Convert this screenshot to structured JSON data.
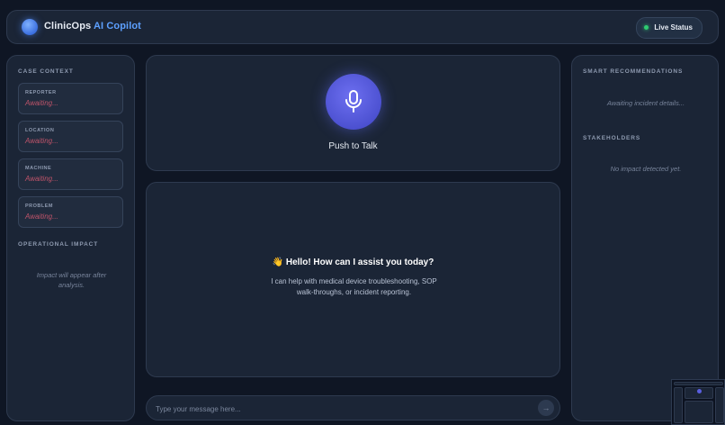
{
  "header": {
    "brand_name": "ClinicOps",
    "brand_accent": "AI Copilot",
    "status_label": "Live Status"
  },
  "case_context": {
    "title": "CASE CONTEXT",
    "fields": [
      {
        "label": "REPORTER",
        "value": "Awaiting..."
      },
      {
        "label": "LOCATION",
        "value": "Awaiting..."
      },
      {
        "label": "MACHINE",
        "value": "Awaiting..."
      },
      {
        "label": "PROBLEM",
        "value": "Awaiting..."
      }
    ]
  },
  "operational_impact": {
    "title": "OPERATIONAL IMPACT",
    "placeholder_line1": "Impact will appear after",
    "placeholder_line2": "analysis."
  },
  "talk": {
    "label": "Push to Talk",
    "icon": "microphone-icon"
  },
  "chat": {
    "greeting_title": "👋 Hello! How can I assist you today?",
    "greeting_line1": "I can help with medical device troubleshooting, SOP",
    "greeting_line2": "walk-throughs, or incident reporting."
  },
  "composer": {
    "placeholder": "Type your message here...",
    "send_icon": "arrow-right-icon"
  },
  "recommendations": {
    "title": "SMART RECOMMENDATIONS",
    "placeholder": "Awaiting incident details..."
  },
  "stakeholders": {
    "title": "STAKEHOLDERS",
    "placeholder": "No impact detected yet."
  },
  "colors": {
    "background": "#0f1624",
    "panel": "#1b2536",
    "accent": "#5da0ff",
    "mic": "#4a4fcf",
    "awaiting": "#c0546a",
    "status_live": "#2ecc71"
  }
}
